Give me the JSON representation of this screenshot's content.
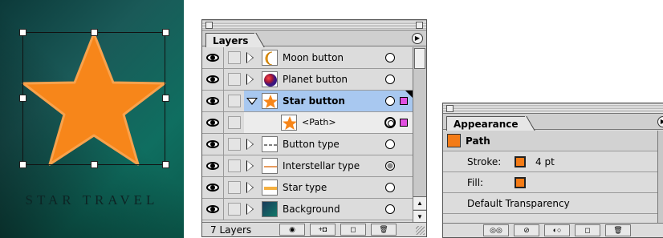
{
  "artwork": {
    "title_text": "STAR TRAVEL",
    "star_color": "#F7861A",
    "star_outline_color": "#F9A24C",
    "background_colors": [
      "#0B2F2F",
      "#0F6E60"
    ]
  },
  "layers_panel": {
    "tab_label": "Layers",
    "layers": [
      {
        "name": "Moon button",
        "icon": "moon-thumbnail",
        "expanded": false,
        "selected": false
      },
      {
        "name": "Planet button",
        "icon": "planet-thumbnail",
        "expanded": false,
        "selected": false
      },
      {
        "name": "Star button",
        "icon": "star-thumbnail",
        "expanded": true,
        "selected": true
      },
      {
        "name": "<Path>",
        "icon": "star-thumbnail",
        "sublayer": true
      },
      {
        "name": "Button type",
        "icon": "button-type-thumbnail",
        "expanded": false,
        "selected": false
      },
      {
        "name": "Interstellar type",
        "icon": "interstellar-type-thumbnail",
        "expanded": false,
        "selected": false
      },
      {
        "name": "Star type",
        "icon": "star-type-thumbnail",
        "expanded": false,
        "selected": false
      },
      {
        "name": "Background",
        "icon": "background-thumbnail",
        "expanded": false,
        "selected": false
      }
    ],
    "layer_count": "7 Layers",
    "selection_color": "#A8C8F0",
    "highlight_color": "#E050E0"
  },
  "appearance_panel": {
    "tab_label": "Appearance",
    "object_label": "Path",
    "stroke_label": "Stroke:",
    "stroke_value": "4 pt",
    "fill_label": "Fill:",
    "transparency_label": "Default Transparency",
    "swatch_color": "#F47B16"
  }
}
